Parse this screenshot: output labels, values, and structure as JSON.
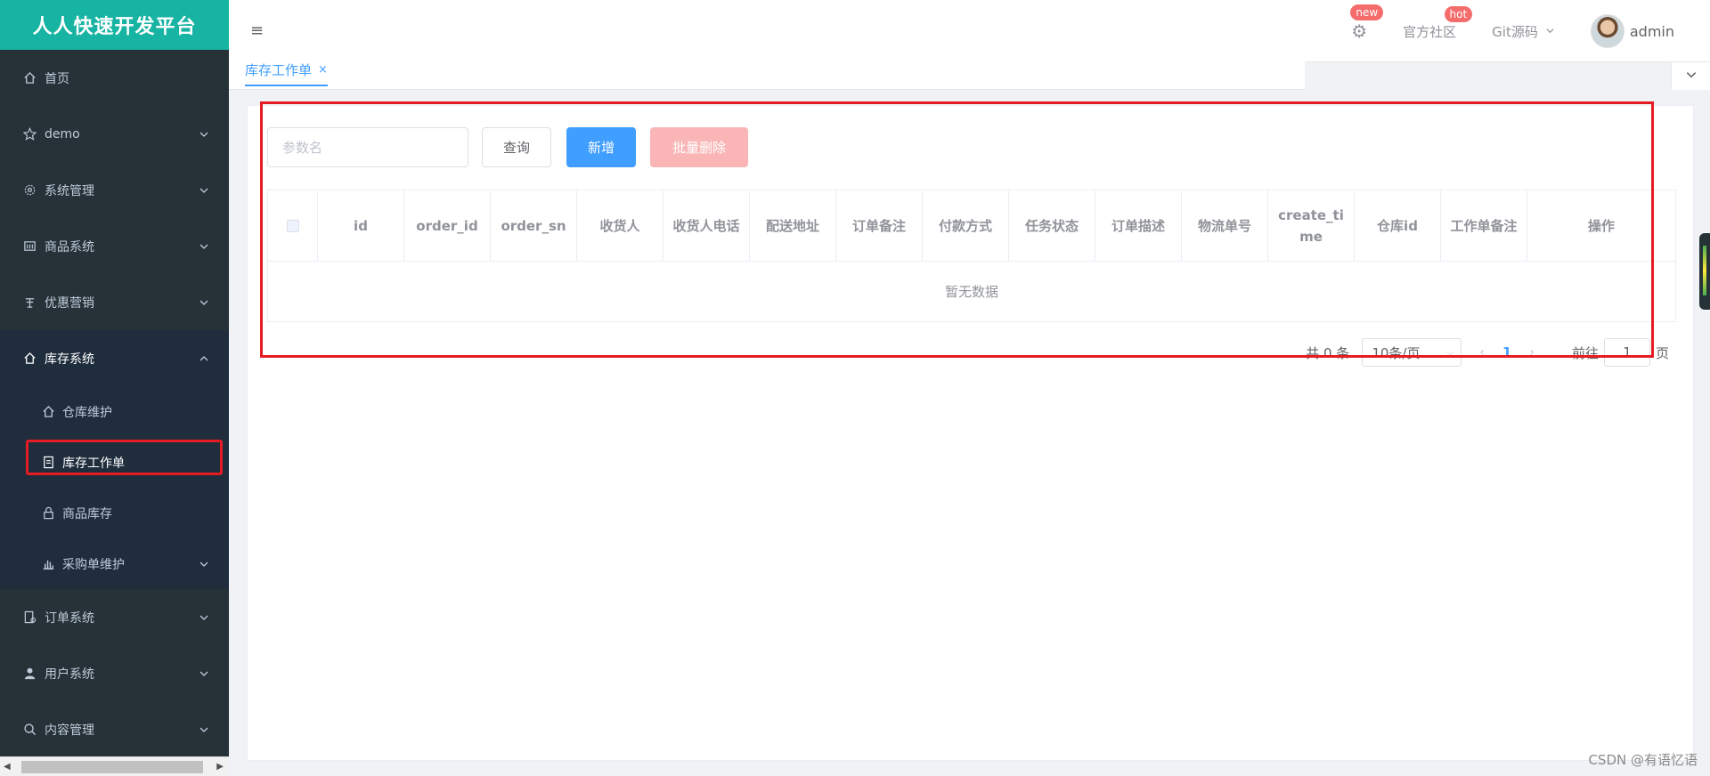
{
  "brand": "人人快速开发平台",
  "header": {
    "hamburger_icon": "menu-icon",
    "settings_badge": "new",
    "community_label": "官方社区",
    "community_badge": "hot",
    "git_label": "Git源码",
    "username": "admin"
  },
  "sidebar": {
    "items": [
      {
        "label": "首页",
        "icon": "home-icon"
      },
      {
        "label": "demo",
        "icon": "star-icon"
      },
      {
        "label": "系统管理",
        "icon": "gear-icon"
      },
      {
        "label": "商品系统",
        "icon": "product-icon"
      },
      {
        "label": "优惠营销",
        "icon": "coupon-icon"
      },
      {
        "label": "库存系统",
        "icon": "home-icon"
      },
      {
        "label": "订单系统",
        "icon": "order-icon"
      },
      {
        "label": "用户系统",
        "icon": "user-icon"
      },
      {
        "label": "内容管理",
        "icon": "search-icon"
      }
    ],
    "stock_subitems": [
      {
        "label": "仓库维护",
        "icon": "warehouse-icon"
      },
      {
        "label": "库存工作单",
        "icon": "document-icon"
      },
      {
        "label": "商品库存",
        "icon": "lock-icon"
      },
      {
        "label": "采购单维护",
        "icon": "chart-icon"
      }
    ]
  },
  "tabs": [
    {
      "label": "库存工作单",
      "close": "×"
    }
  ],
  "toolbar": {
    "search_placeholder": "参数名",
    "query_label": "查询",
    "add_label": "新增",
    "batch_delete_label": "批量删除"
  },
  "table": {
    "columns": [
      "id",
      "order_id",
      "order_sn",
      "收货人",
      "收货人电话",
      "配送地址",
      "订单备注",
      "付款方式",
      "任务状态",
      "订单描述",
      "物流单号",
      "create_time",
      "仓库id",
      "工作单备注",
      "操作"
    ],
    "empty_text": "暂无数据"
  },
  "pagination": {
    "total": "共 0 条",
    "page_size": "10条/页",
    "current_page": "1",
    "goto_label": "前往",
    "goto_value": "1",
    "page_suffix": "页"
  },
  "watermark": "CSDN @有语忆语",
  "colors": {
    "brand": "#17b3a3",
    "sidebar": "#263238",
    "primary": "#409eff",
    "danger_light": "#fab6b6",
    "highlight": "#e51c23"
  }
}
